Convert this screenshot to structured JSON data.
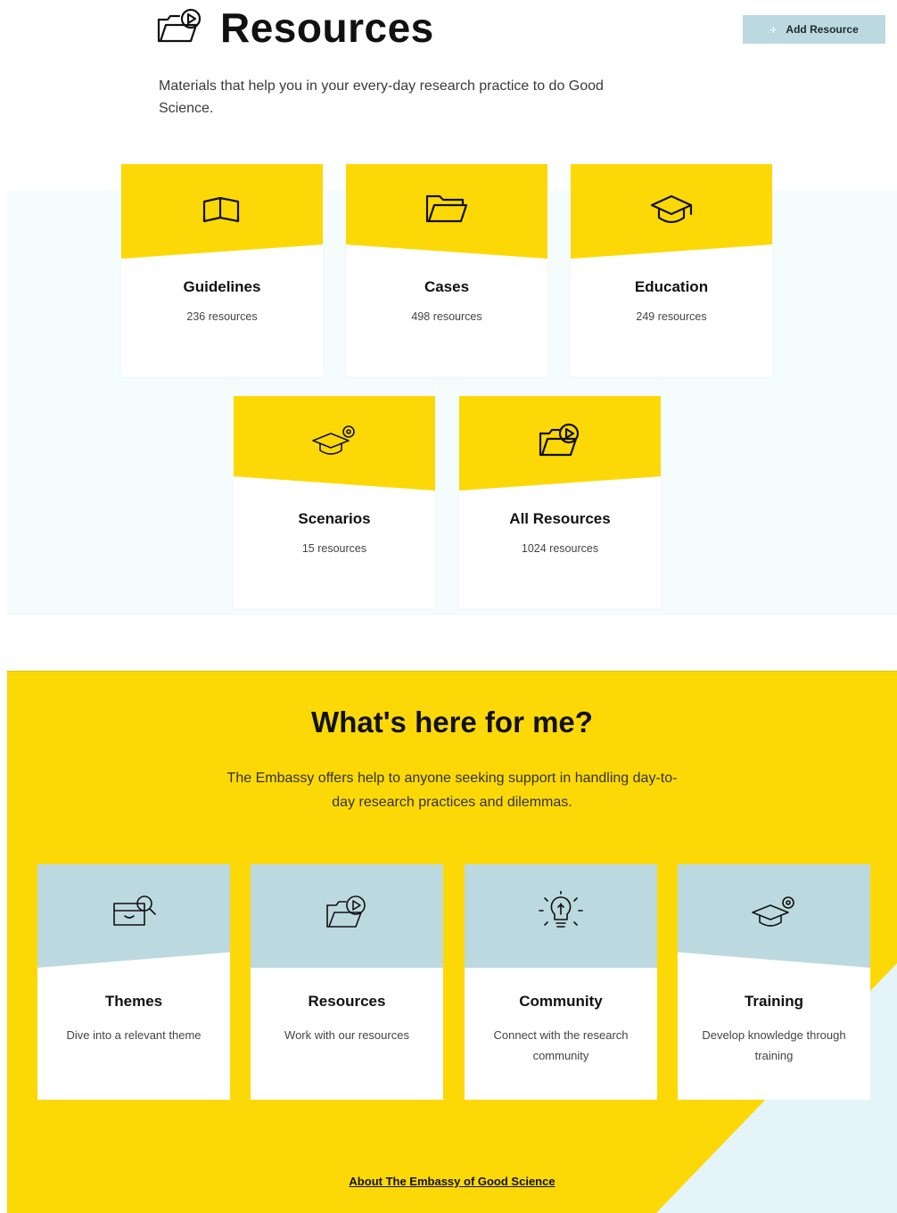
{
  "header": {
    "title": "Resources",
    "subtitle": "Materials that help you in your every-day research practice to do Good Science.",
    "add_button_label": "Add Resource"
  },
  "categories": [
    {
      "name": "Guidelines",
      "count": "236 resources",
      "icon": "book-open-icon"
    },
    {
      "name": "Cases",
      "count": "498 resources",
      "icon": "folder-icon"
    },
    {
      "name": "Education",
      "count": "249 resources",
      "icon": "graduation-cap-icon"
    },
    {
      "name": "Scenarios",
      "count": "15 resources",
      "icon": "cap-gear-icon"
    },
    {
      "name": "All Resources",
      "count": "1024 resources",
      "icon": "folder-play-icon"
    }
  ],
  "section": {
    "title": "What's here for me?",
    "description": "The Embassy offers help to anyone seeking support in handling day-to-day research practices and dilemmas.",
    "features": [
      {
        "name": "Themes",
        "description": "Dive into a relevant theme",
        "icon": "box-search-icon"
      },
      {
        "name": "Resources",
        "description": "Work with our resources",
        "icon": "folder-play-icon"
      },
      {
        "name": "Community",
        "description": "Connect with the research community",
        "icon": "lightbulb-icon"
      },
      {
        "name": "Training",
        "description": "Develop knowledge through training",
        "icon": "cap-gear-icon"
      }
    ],
    "about_link": "About The Embassy of Good Science"
  },
  "colors": {
    "accent_yellow": "#fcd906",
    "accent_blue": "#bcd9e0",
    "band_bg": "#f5fcfd"
  }
}
